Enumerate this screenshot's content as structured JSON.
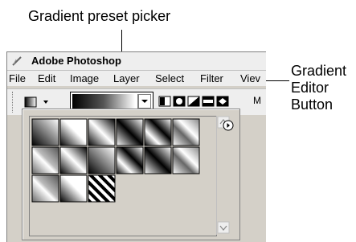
{
  "callouts": {
    "picker": "Gradient preset picker",
    "editor_lines": [
      "Gradient",
      "Editor",
      "Button"
    ]
  },
  "window": {
    "title": "Adobe Photoshop",
    "menu": [
      "File",
      "Edit",
      "Image",
      "Layer",
      "Select",
      "Filter",
      "Viev"
    ],
    "options_more": "M"
  },
  "icons": {
    "app": "photoshop-feather-icon",
    "tool": "gradient-tool-icon",
    "dropdown": "chevron-down-icon",
    "styles": "gradient-style-icons",
    "panel_menu": "circle-arrow-icon",
    "scroll_up": "scroll-up-arrow-icon",
    "scroll_down": "scroll-down-arrow-icon"
  },
  "presets": {
    "count": 15,
    "colors": {
      "dark": "#000000",
      "light": "#ffffff",
      "mid": "#808080"
    }
  }
}
